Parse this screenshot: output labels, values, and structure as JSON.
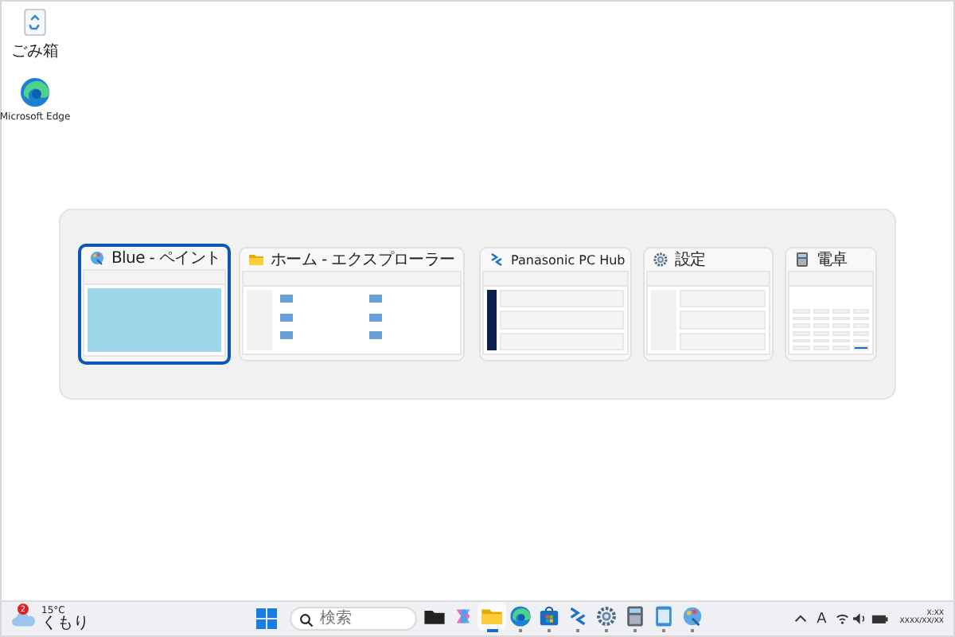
{
  "desktop_icons": [
    {
      "kind": "recycle",
      "label": "ごみ箱"
    },
    {
      "kind": "edge",
      "label": "Microsoft Edge"
    }
  ],
  "switcher": {
    "windows": [
      {
        "kind": "paint",
        "title": "Blue - ペイント",
        "selected": true
      },
      {
        "kind": "explorer",
        "title": "ホーム - エクスプローラー",
        "selected": false
      },
      {
        "kind": "hub",
        "title": "Panasonic PC Hub",
        "selected": false
      },
      {
        "kind": "settings",
        "title": "設定",
        "selected": false
      },
      {
        "kind": "calc",
        "title": "電卓",
        "selected": false
      }
    ]
  },
  "taskbar": {
    "weather": {
      "badge": "2",
      "temperature": "15°C",
      "condition": "くもり"
    },
    "search": {
      "placeholder": "検索"
    },
    "apps": [
      {
        "kind": "darkfolder",
        "running": false,
        "active": false
      },
      {
        "kind": "copilot",
        "running": false,
        "active": false
      },
      {
        "kind": "explorer",
        "running": true,
        "active": true
      },
      {
        "kind": "edge",
        "running": true,
        "active": false
      },
      {
        "kind": "store",
        "running": true,
        "active": false
      },
      {
        "kind": "hub",
        "running": true,
        "active": false
      },
      {
        "kind": "settings",
        "running": true,
        "active": false
      },
      {
        "kind": "calc",
        "running": true,
        "active": false
      },
      {
        "kind": "notepad",
        "running": true,
        "active": false
      },
      {
        "kind": "paint",
        "running": true,
        "active": false
      }
    ],
    "ime": "A",
    "time": "X:XX",
    "date": "XXXX/XX/XX"
  }
}
